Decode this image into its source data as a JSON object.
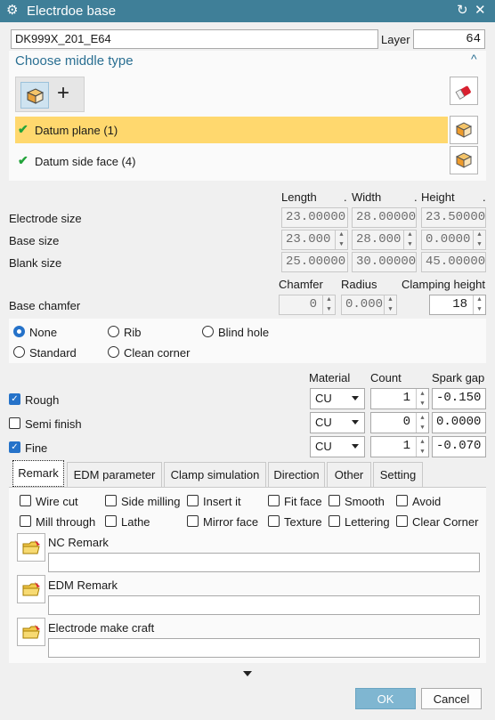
{
  "window": {
    "title": "Electrdoe base",
    "settings_icon": "gear-icon",
    "refresh_icon": "refresh-icon",
    "close_icon": "close-icon"
  },
  "top": {
    "name_value": "DK999X_201_E64",
    "layer_label": "Layer",
    "layer_value": "64"
  },
  "middle": {
    "title": "Choose middle type",
    "items": [
      {
        "label": "Datum plane (1)",
        "selected": true
      },
      {
        "label": "Datum side face (4)",
        "selected": false
      }
    ]
  },
  "size": {
    "headers": {
      "length": "Length",
      "width": "Width",
      "height": "Height"
    },
    "electrode": {
      "label": "Electrode size",
      "length": "23.00000",
      "width": "28.00000",
      "height": "23.50000"
    },
    "base": {
      "label": "Base size",
      "length": "23.000",
      "width": "28.000",
      "height": "0.0000"
    },
    "blank": {
      "label": "Blank size",
      "length": "25.00000",
      "width": "30.00000",
      "height": "45.00000"
    }
  },
  "chamfer": {
    "headers": {
      "chamfer": "Chamfer",
      "radius": "Radius",
      "clamping": "Clamping height"
    },
    "label": "Base chamfer",
    "chamfer_value": "0",
    "radius_value": "0.000",
    "clamping_value": "18"
  },
  "corner_options": [
    {
      "label": "None",
      "on": true
    },
    {
      "label": "Rib",
      "on": false
    },
    {
      "label": "Blind hole",
      "on": false
    },
    {
      "label": "Standard",
      "on": false
    },
    {
      "label": "Clean corner",
      "on": false
    }
  ],
  "machining": {
    "headers": {
      "material": "Material",
      "count": "Count",
      "spark": "Spark gap"
    },
    "rows": [
      {
        "label": "Rough",
        "checked": true,
        "material": "CU",
        "count": "1",
        "spark": "-0.150"
      },
      {
        "label": "Semi finish",
        "checked": false,
        "material": "CU",
        "count": "0",
        "spark": "0.0000"
      },
      {
        "label": "Fine",
        "checked": true,
        "material": "CU",
        "count": "1",
        "spark": "-0.070"
      }
    ]
  },
  "tabs": [
    "Remark",
    "EDM parameter",
    "Clamp simulation",
    "Direction",
    "Other",
    "Setting"
  ],
  "options": {
    "row1": [
      "Wire cut",
      "Side milling",
      "Insert it",
      "Fit face",
      "Smooth",
      "Avoid"
    ],
    "row2": [
      "Mill through",
      "Lathe",
      "Mirror face",
      "Texture",
      "Lettering",
      "Clear Corner"
    ]
  },
  "remarks": [
    "NC Remark",
    "EDM Remark",
    "Electrode make craft"
  ],
  "footer": {
    "ok": "OK",
    "cancel": "Cancel"
  },
  "colors": {
    "accent": "#3f7f98",
    "highlight": "#ffd86e",
    "ok_button": "#7fb6d1",
    "check_blue": "#2572c9",
    "check_green": "#22a33a"
  }
}
